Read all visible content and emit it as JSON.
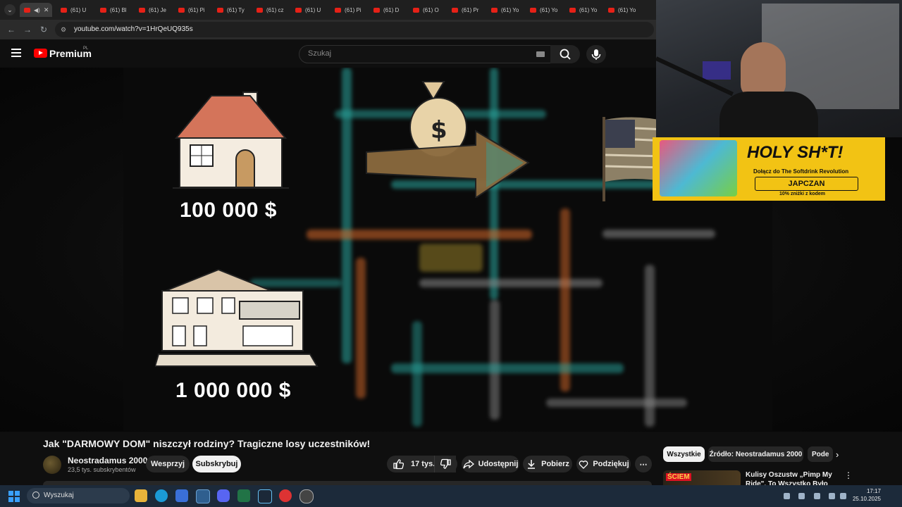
{
  "browser": {
    "tabs": [
      {
        "label": "(61) U"
      },
      {
        "label": "(61) Bl"
      },
      {
        "label": "(61) Je"
      },
      {
        "label": "(61) Pi"
      },
      {
        "label": "(61) Ty"
      },
      {
        "label": "(61) cz"
      },
      {
        "label": "(61) U"
      },
      {
        "label": "(61) Pi"
      },
      {
        "label": "(61) D"
      },
      {
        "label": "(61) O"
      },
      {
        "label": "(61) Pr"
      },
      {
        "label": "(61) Yo"
      },
      {
        "label": "(61) Yo"
      },
      {
        "label": "(61) Yo"
      },
      {
        "label": "(61) Yo"
      }
    ],
    "url": "youtube.com/watch?v=1HrQeUQ935s"
  },
  "masthead": {
    "brand": "Premium",
    "region": "PL",
    "search_placeholder": "Szukaj"
  },
  "video": {
    "price_small": "100 000 $",
    "price_large": "1 000 000 $",
    "title": "Jak \"DARMOWY DOM\" niszczył rodziny? Tragiczne losy uczestników!"
  },
  "overlay": {
    "headline": "HOLY SH*T!",
    "line1": "Dołącz do The Softdrink Revolution",
    "code": "JAPCZAN",
    "line2": "10% zniżki z kodem"
  },
  "channel": {
    "name": "Neostradamus 2000",
    "subscribers": "23,5 tys. subskrybentów",
    "join": "Wesprzyj",
    "subscribe": "Subskrybuj"
  },
  "actions": {
    "likes": "17 tys.",
    "share": "Udostępnij",
    "download": "Pobierz",
    "thanks": "Podziękuj"
  },
  "chips": [
    "Wszystkie",
    "Źródło: Neostradamus 2000",
    "Pode"
  ],
  "recommendation": {
    "title": "Kulisy Oszustw „Pimp My Ride\". To Wszystko Było Ustawione!"
  },
  "taskbar": {
    "search": "Wyszukaj",
    "time": "17:17",
    "date": "25.10.2025"
  },
  "colors": {
    "accent": "#ff0000",
    "pipe_teal": "#2aa8a0",
    "pipe_orange": "#d96a2a",
    "ad_yellow": "#f2c314"
  }
}
